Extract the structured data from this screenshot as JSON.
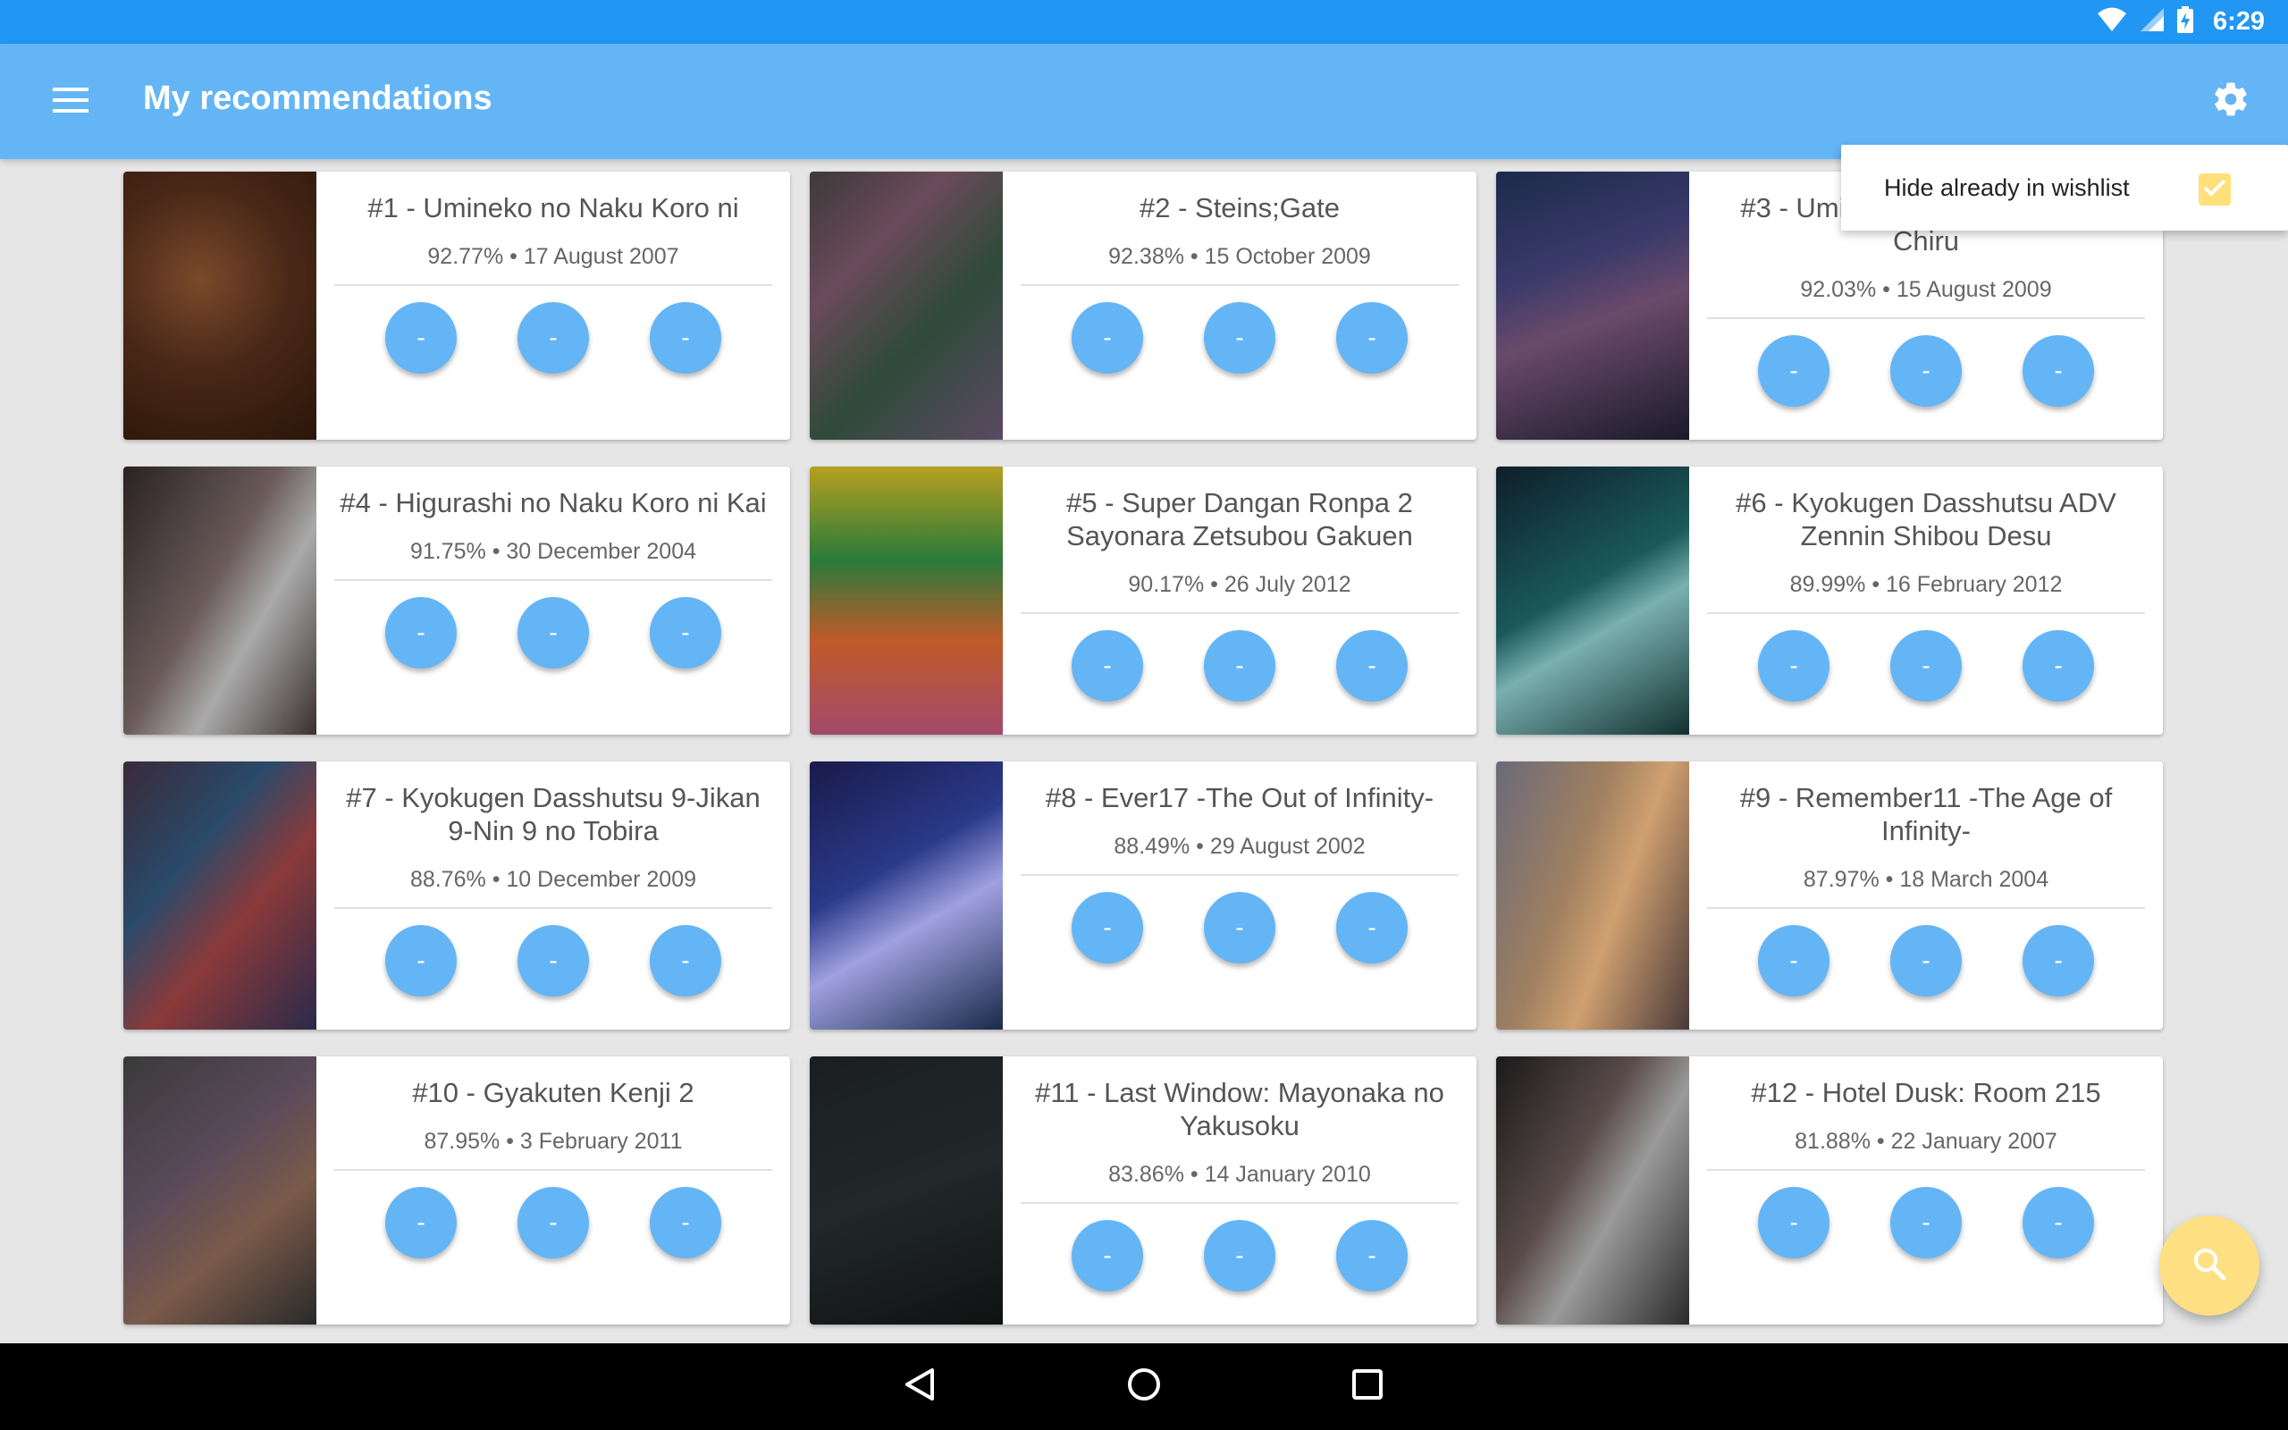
{
  "status_bar": {
    "time": "6:29",
    "icons": [
      "wifi-icon",
      "signal-icon",
      "battery-charging-icon"
    ]
  },
  "app_bar": {
    "title": "My recommendations",
    "menu_icon": "hamburger-menu-icon",
    "settings_icon": "gear-icon"
  },
  "popup": {
    "label": "Hide already in wishlist",
    "checked": true
  },
  "cards": [
    {
      "title": "#1 - Umineko no Naku Koro ni",
      "meta": "92.77% • 17 August 2007",
      "buttons": [
        "-",
        "-",
        "-"
      ]
    },
    {
      "title": "#2 - Steins;Gate",
      "meta": "92.38% • 15 October 2009",
      "buttons": [
        "-",
        "-",
        "-"
      ]
    },
    {
      "title": "#3 - Umineko no Naku Koro ni Chiru",
      "meta": "92.03% • 15 August 2009",
      "buttons": [
        "-",
        "-",
        "-"
      ]
    },
    {
      "title": "#4 - Higurashi no Naku Koro ni Kai",
      "meta": "91.75% • 30 December 2004",
      "buttons": [
        "-",
        "-",
        "-"
      ]
    },
    {
      "title": "#5 - Super Dangan Ronpa 2 Sayonara Zetsubou Gakuen",
      "meta": "90.17% • 26 July 2012",
      "buttons": [
        "-",
        "-",
        "-"
      ]
    },
    {
      "title": "#6 - Kyokugen Dasshutsu ADV Zennin Shibou Desu",
      "meta": "89.99% • 16 February 2012",
      "buttons": [
        "-",
        "-",
        "-"
      ]
    },
    {
      "title": "#7 - Kyokugen Dasshutsu 9-Jikan 9-Nin 9 no Tobira",
      "meta": "88.76% • 10 December 2009",
      "buttons": [
        "-",
        "-",
        "-"
      ]
    },
    {
      "title": "#8 - Ever17 -The Out of Infinity-",
      "meta": "88.49% • 29 August 2002",
      "buttons": [
        "-",
        "-",
        "-"
      ]
    },
    {
      "title": "#9 - Remember11 -The Age of Infinity-",
      "meta": "87.97% • 18 March 2004",
      "buttons": [
        "-",
        "-",
        "-"
      ]
    },
    {
      "title": "#10 - Gyakuten Kenji 2",
      "meta": "87.95% • 3 February 2011",
      "buttons": [
        "-",
        "-",
        "-"
      ]
    },
    {
      "title": "#11 - Last Window: Mayonaka no Yakusoku",
      "meta": "83.86% • 14 January 2010",
      "buttons": [
        "-",
        "-",
        "-"
      ]
    },
    {
      "title": "#12 - Hotel Dusk: Room 215",
      "meta": "81.88% • 22 January 2007",
      "buttons": [
        "-",
        "-",
        "-"
      ]
    }
  ],
  "fab": {
    "icon": "search-icon"
  },
  "nav_bar": {
    "icons": [
      "back-icon",
      "home-icon",
      "recents-icon"
    ]
  },
  "colors": {
    "status_bar": "#2196f3",
    "app_bar": "#64b5f6",
    "button": "#64b5f6",
    "fab": "#ffe082",
    "checkbox": "#ffe07a",
    "background": "#e6e6e6"
  }
}
